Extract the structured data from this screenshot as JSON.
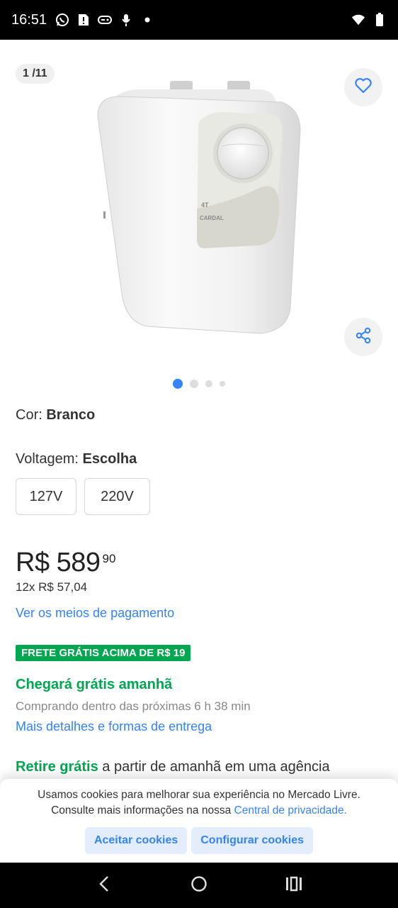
{
  "status_bar": {
    "time": "16:51",
    "left_icons": [
      "whatsapp-icon",
      "alert-icon",
      "gamepad-icon",
      "mic-icon",
      "dot-icon"
    ],
    "right_icons": [
      "wifi-icon",
      "battery-icon"
    ]
  },
  "gallery": {
    "counter": "1 /11",
    "total_dots": 4,
    "active_dot": 0,
    "accent": "#3483fa",
    "product_brand": "CARDAL",
    "product_model": "4T"
  },
  "product": {
    "cor_label": "Cor: ",
    "cor_value": "Branco",
    "voltagem_label": "Voltagem: ",
    "voltagem_value": "Escolha",
    "voltage_options": [
      "127V",
      "220V"
    ],
    "price_main": "R$ 589",
    "price_cents": "90",
    "installments": "12x R$ 57,04",
    "payment_link": "Ver os meios de pagamento",
    "frete_badge": "FRETE GRÁTIS ACIMA DE R$ 19",
    "chegara": "Chegará grátis amanhã",
    "comprando": "Comprando dentro das próximas 6 h 38 min",
    "mais_detalhes": "Mais detalhes e formas de entrega",
    "retire_green": "Retire grátis",
    "retire_rest": " a partir de amanhã em uma agência"
  },
  "cookie": {
    "line1": "Usamos cookies para melhorar sua experiência no Mercado Livre.",
    "line2_prefix": "Consulte mais informações na nossa ",
    "line2_link": "Central de privacidade.",
    "accept": "Aceitar cookies",
    "configure": "Configurar cookies"
  },
  "colors": {
    "link": "#3483fa",
    "green": "#00a650"
  }
}
